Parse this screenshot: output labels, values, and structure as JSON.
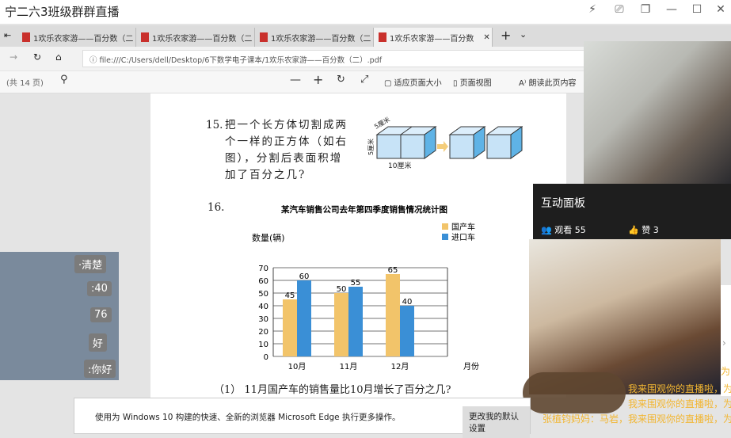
{
  "window": {
    "title": "宁二六3班级群群直播"
  },
  "browser": {
    "tabs": [
      {
        "label": "1欢乐农家游——百分数（二"
      },
      {
        "label": "1欢乐农家游——百分数（二"
      },
      {
        "label": "1欢乐农家游——百分数（二"
      },
      {
        "label": "1欢乐农家游——百分数",
        "active": true
      }
    ],
    "url": "file:///C:/Users/dell/Desktop/6下数学电子课本/1欢乐农家游——百分数（二）.pdf"
  },
  "pdf_toolbar": {
    "page_count": "(共 14 页)",
    "fit_page": "适应页面大小",
    "page_view": "页面视图",
    "read_aloud": "朗读此页内容"
  },
  "page": {
    "q15": {
      "num": "15.",
      "lines": [
        "把一个长方体切割成两",
        "个一样的正方体（如右",
        "图），分割后表面积增",
        "加了百分之几?"
      ],
      "dim_a": "5厘米",
      "dim_b": "5厘米",
      "dim_c": "10厘米"
    },
    "q16": {
      "num": "16.",
      "sub1": "（1） 11月国产车的销售量比10月增长了百分之几?"
    }
  },
  "chart_data": {
    "type": "bar",
    "title": "某汽车销售公司去年第四季度销售情况统计图",
    "ylabel": "数量(辆)",
    "xlabel": "月份",
    "categories": [
      "10月",
      "11月",
      "12月"
    ],
    "ylim": [
      0,
      70
    ],
    "yticks": [
      0,
      10,
      20,
      30,
      40,
      50,
      60,
      70
    ],
    "series": [
      {
        "name": "国产车",
        "color": "#f2c46a",
        "values": [
          45,
          50,
          65
        ]
      },
      {
        "name": "进口车",
        "color": "#3a8fd6",
        "values": [
          60,
          55,
          40
        ]
      }
    ],
    "legend": "top-right",
    "grid": true
  },
  "panel": {
    "title": "互动面板",
    "viewers": "观看 55",
    "likes": "赞 3"
  },
  "chat": [
    "为",
    "我来围观你的直播啦，为",
    "我来围观你的直播啦，为",
    "张植钧妈妈：马岩，我来围观你的直播啦，为"
  ],
  "left_chat": [
    "·清楚",
    ":40",
    "76",
    "好",
    ":你好"
  ],
  "notice": {
    "text": "使用为 Windows 10 构建的快速、全新的浏览器 Microsoft Edge 执行更多操作。",
    "button": "更改我的默认设置"
  }
}
